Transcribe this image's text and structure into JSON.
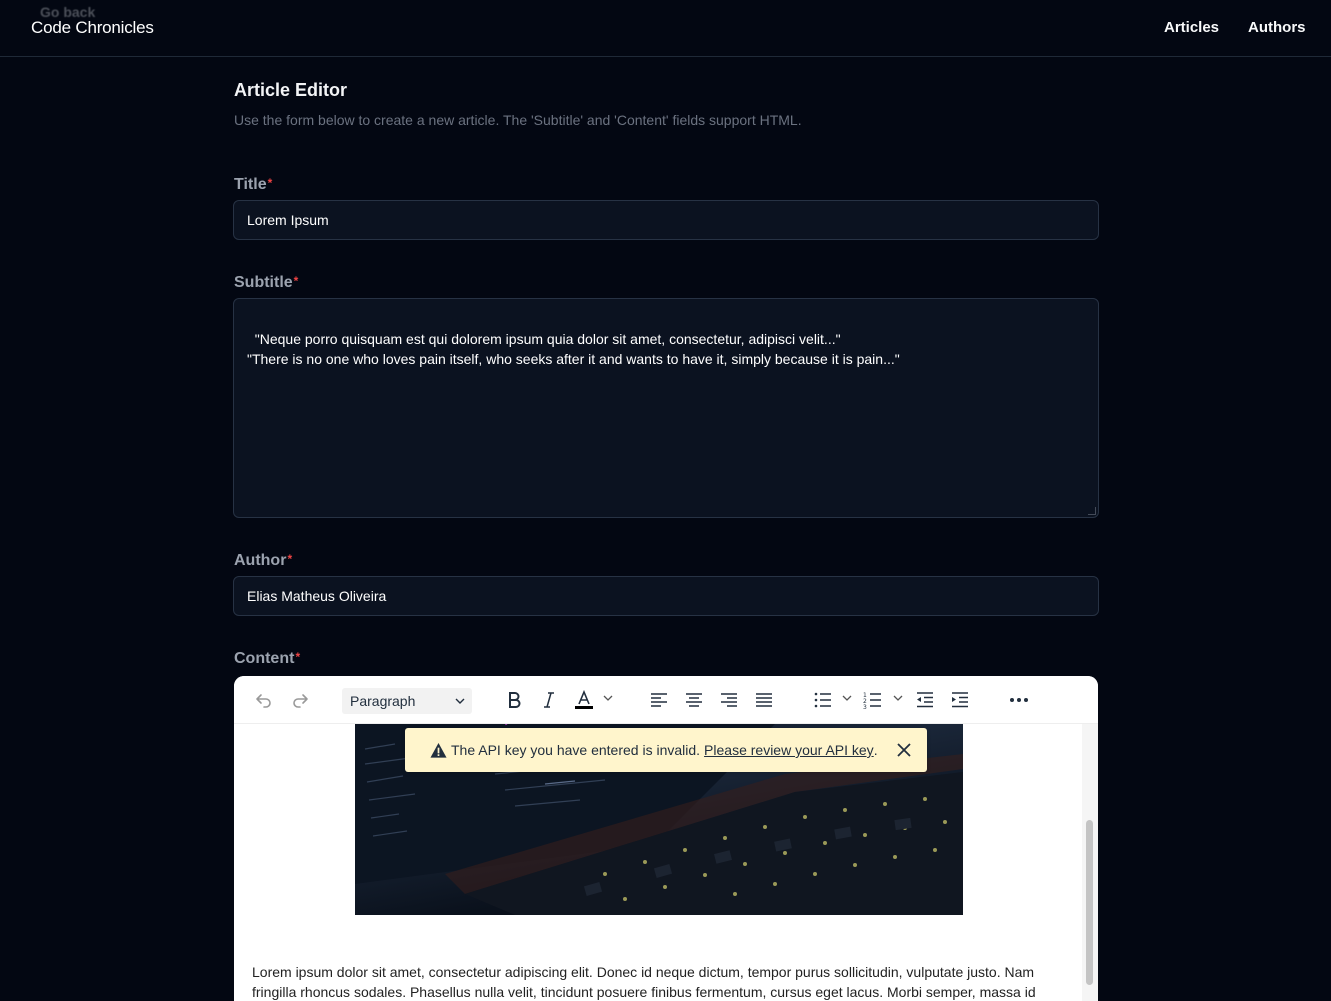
{
  "header": {
    "back_label": "Go back",
    "brand": "Code Chronicles",
    "nav": [
      "Articles",
      "Authors"
    ]
  },
  "form": {
    "title": "Article Editor",
    "description": "Use the form below to create a new article. The 'Subtitle' and 'Content' fields support HTML.",
    "required_marker": "*",
    "title_label": "Title",
    "title_value": "Lorem Ipsum",
    "subtitle_label": "Subtitle",
    "subtitle_value": "\"Neque porro quisquam est qui dolorem ipsum quia dolor sit amet, consectetur, adipisci velit...\"\n\"There is no one who loves pain itself, who seeks after it and wants to have it, simply because it is pain...\"",
    "author_label": "Author",
    "author_value": "Elias Matheus Oliveira",
    "content_label": "Content"
  },
  "editor": {
    "block_format": "Paragraph",
    "toolbar_icons": [
      "undo-icon",
      "redo-icon",
      "bold-icon",
      "italic-icon",
      "text-color-icon",
      "align-left-icon",
      "align-center-icon",
      "align-right-icon",
      "justify-icon",
      "bullet-list-icon",
      "numbered-list-icon",
      "outdent-icon",
      "indent-icon",
      "more-icon"
    ],
    "warning_text": "The API key you have entered is invalid.",
    "warning_link": "Please review your API key",
    "warning_end": ".",
    "content_paragraph": "Lorem ipsum dolor sit amet, consectetur adipiscing elit. Donec id neque dictum, tempor purus sollicitudin, vulputate justo. Nam fringilla rhoncus sodales. Phasellus nulla velit, tincidunt posuere finibus fermentum, cursus eget lacus. Morbi semper, massa id"
  },
  "colors": {
    "background": "#030712",
    "input_bg": "#0b1220",
    "label": "#9ca3af",
    "required": "#ef4444",
    "warning_bg": "#fff5cc"
  }
}
